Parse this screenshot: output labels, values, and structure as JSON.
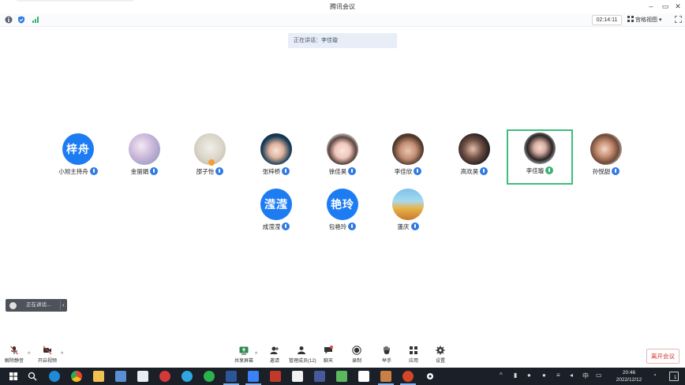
{
  "window": {
    "title": "腾讯会议",
    "min_icon": "minimize-icon",
    "max_icon": "maximize-icon",
    "close_icon": "close-icon"
  },
  "statusbar": {
    "icons": [
      "info-icon",
      "shield-icon",
      "signal-icon"
    ],
    "timer": "02:14:11",
    "view_label": "宫格视图",
    "fullscreen_icon": "fullscreen-icon"
  },
  "banner": {
    "speaking": "正在讲话：李佳璇"
  },
  "participants": [
    {
      "name": "小旭主持舟",
      "avatar_text": "梓舟",
      "type": "text"
    },
    {
      "name": "金丽娟",
      "avatar_text": "",
      "type": "photo"
    },
    {
      "name": "邵子怡",
      "avatar_text": "",
      "type": "photo"
    },
    {
      "name": "张梓桥",
      "avatar_text": "",
      "type": "photo"
    },
    {
      "name": "徐佳昊",
      "avatar_text": "",
      "type": "photo"
    },
    {
      "name": "李佳欣",
      "avatar_text": "",
      "type": "photo"
    },
    {
      "name": "高欢昊",
      "avatar_text": "",
      "type": "photo"
    },
    {
      "name": "李佳璇",
      "avatar_text": "",
      "type": "photo"
    },
    {
      "name": "孙悦甜",
      "avatar_text": "",
      "type": "photo"
    },
    {
      "name": "成滢滢",
      "avatar_text": "滢滢",
      "type": "text"
    },
    {
      "name": "包艳玲",
      "avatar_text": "艳玲",
      "type": "text"
    },
    {
      "name": "蓬庆",
      "avatar_text": "",
      "type": "photo"
    }
  ],
  "mini_panel": {
    "label": "正在讲话...",
    "chevron": "‹"
  },
  "controls": {
    "mute": "解除静音",
    "video": "开启视频",
    "share": "共享屏幕",
    "invite": "邀请",
    "members": "管理成员(12)",
    "chat": "聊天",
    "record": "录制",
    "raise": "举手",
    "apps": "应用",
    "settings": "设置",
    "leave": "离开会议",
    "caret": "^"
  },
  "taskbar": {
    "clock_time": "20:46",
    "clock_date": "2022/12/12",
    "ime": "中",
    "notification_count": "1",
    "tray_caret": "^"
  },
  "colors": {
    "accent": "#1e7cf2",
    "speaker_border": "#3fbd7c",
    "leave_text": "#d6332f",
    "taskbar": "#1b1f27"
  }
}
